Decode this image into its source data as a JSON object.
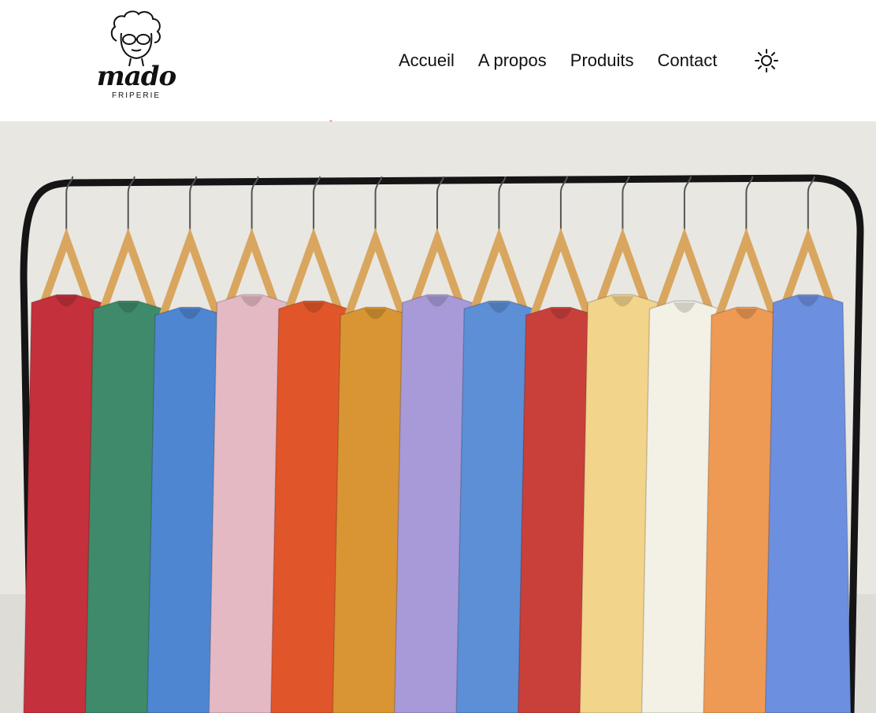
{
  "brand": {
    "name": "mado",
    "subtitle": "FRIPERIE"
  },
  "nav": {
    "items": [
      "Accueil",
      "A propos",
      "Produits",
      "Contact"
    ]
  },
  "theme_toggle": {
    "icon": "sun-icon"
  },
  "hero": {
    "image": "clothing-rack-photo",
    "garment_colors": [
      "#c4303b",
      "#3f8a6a",
      "#4f86d1",
      "#e5b9c4",
      "#e0562a",
      "#d99533",
      "#a89ad8",
      "#5c8fd6",
      "#c9403b",
      "#f2d48a",
      "#f3f0e6",
      "#ee9a55",
      "#6d8fe0"
    ]
  }
}
